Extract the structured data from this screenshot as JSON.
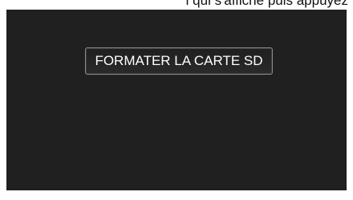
{
  "top_caption": "i qui s'affiche puis appuyez",
  "screen": {
    "menu_button_label": "FORMATER LA CARTE SD"
  }
}
